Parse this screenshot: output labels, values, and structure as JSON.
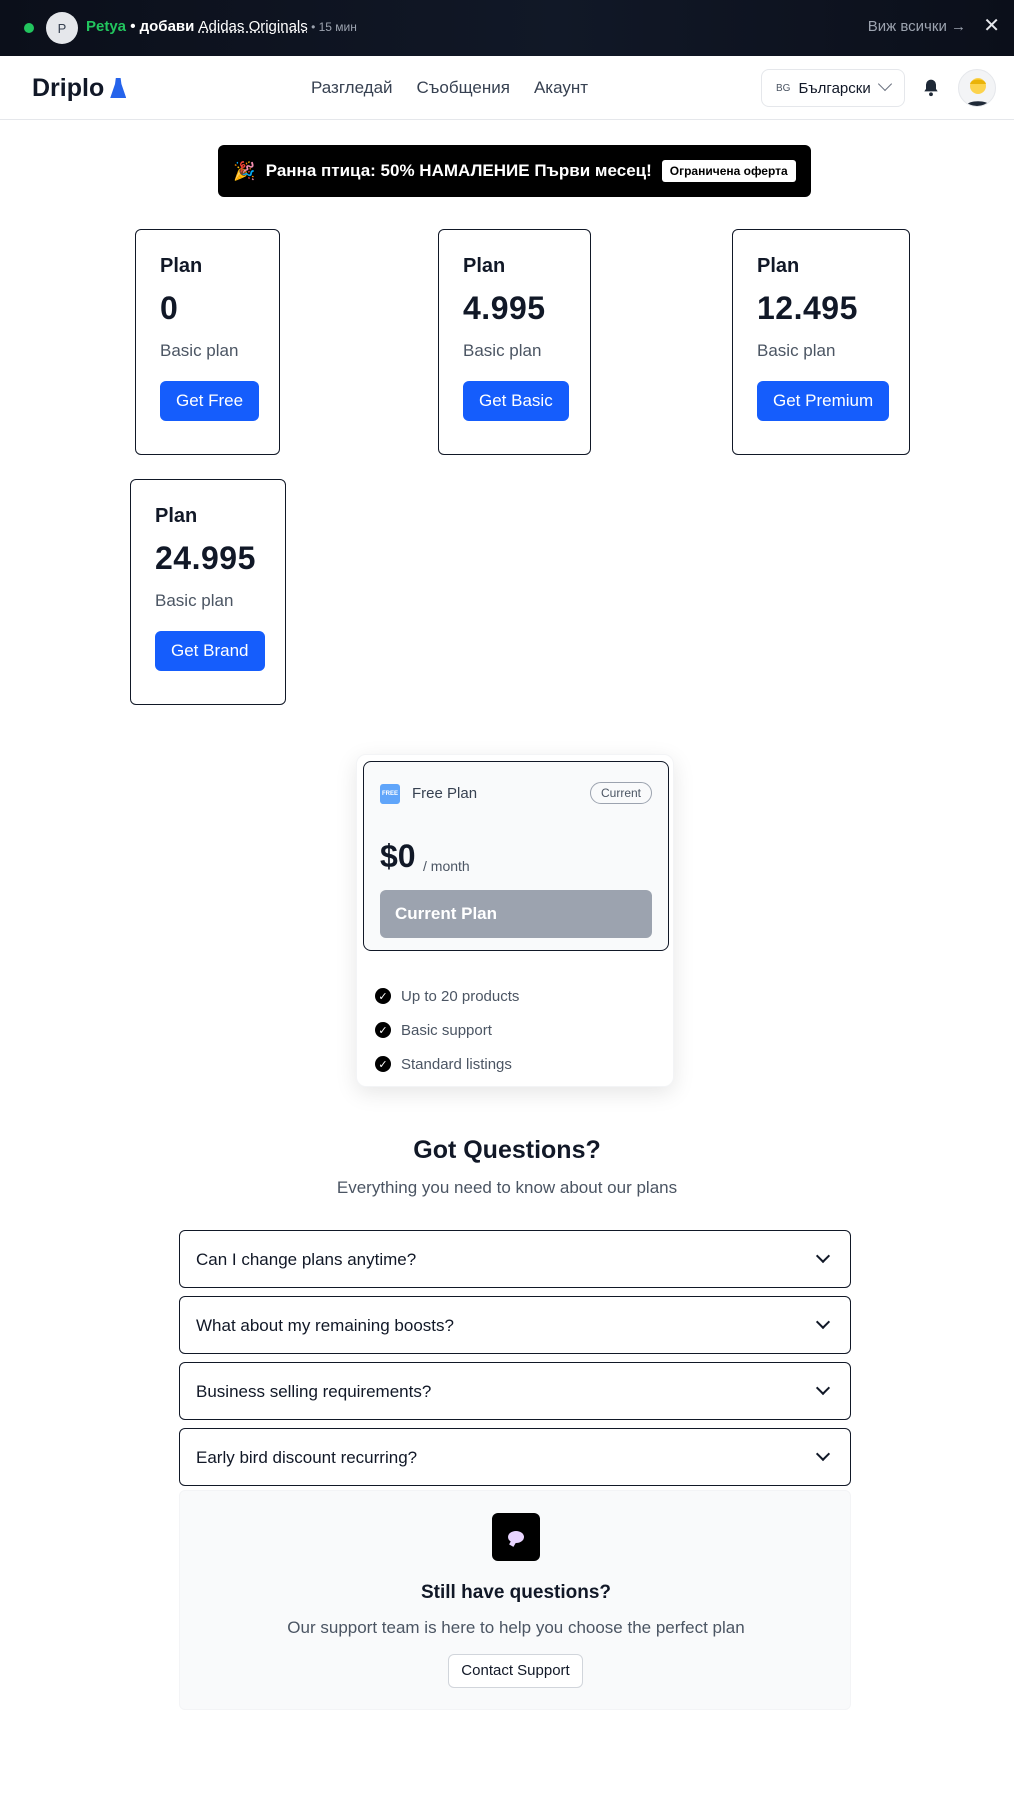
{
  "activity": {
    "avatar_initial": "P",
    "user": "Petya",
    "action": " • добави ",
    "brand": "Adidas Originals",
    "time": " • 15 мин",
    "view_all": "Виж всички →",
    "close": "✕"
  },
  "header": {
    "logo": "Driplo",
    "nav": [
      "Разгледай",
      "Съобщения",
      "Акаунт"
    ],
    "language": {
      "code": "BG",
      "label": "Български"
    }
  },
  "promo": {
    "icon": "🎉",
    "text": "Ранна птица: 50% НАМАЛЕНИЕ Първи месец!",
    "badge": "Ограничена оферта"
  },
  "plans": [
    {
      "title": "Plan",
      "price": "0",
      "description": "Basic plan",
      "button": "Get Free"
    },
    {
      "title": "Plan",
      "price": "4.995",
      "description": "Basic plan",
      "button": "Get Basic"
    },
    {
      "title": "Plan",
      "price": "12.495",
      "description": "Basic plan",
      "button": "Get Premium"
    },
    {
      "title": "Plan",
      "price": "24.995",
      "description": "Basic plan",
      "button": "Get Brand"
    }
  ],
  "current_plan": {
    "icon_text": "FREE",
    "name": "Free Plan",
    "badge": "Current",
    "price": "$0",
    "period": "/ month",
    "button": "Current Plan",
    "features": [
      "Up to 20 products",
      "Basic support",
      "Standard listings"
    ]
  },
  "faq": {
    "title": "Got Questions?",
    "subtitle": "Everything you need to know about our plans",
    "questions": [
      "Can I change plans anytime?",
      "What about my remaining boosts?",
      "Business selling requirements?",
      "Early bird discount recurring?"
    ]
  },
  "support": {
    "title": "Still have questions?",
    "subtitle": "Our support team is here to help you choose the perfect plan",
    "button": "Contact Support"
  },
  "colors": {
    "primary": "#155dfc",
    "live": "#22c55e",
    "disabled": "#9ca3af"
  }
}
